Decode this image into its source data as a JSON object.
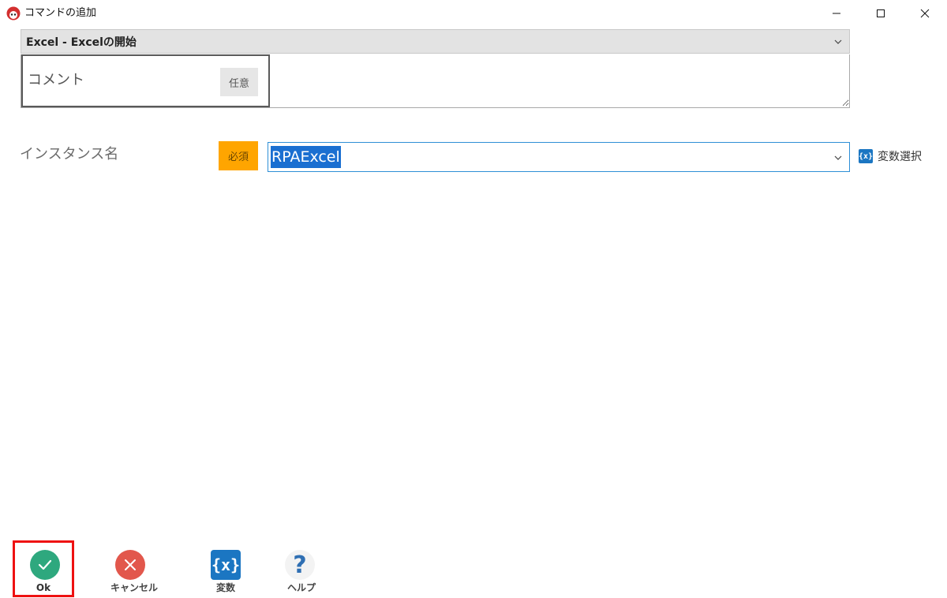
{
  "window": {
    "title": "コマンドの追加",
    "accent": "#d32f2f"
  },
  "command": {
    "selected": "Excel - Excelの開始"
  },
  "comment": {
    "label": "コメント",
    "badge": "任意",
    "value": ""
  },
  "instance": {
    "label": "インスタンス名",
    "badge": "必須",
    "value": "RPAExcel",
    "variable_select": {
      "icon_text": "{x}",
      "label": "変数選択"
    }
  },
  "toolbar": {
    "ok_label": "Ok",
    "cancel_label": "キャンセル",
    "variables_icon_text": "{x}",
    "variables_label": "変数",
    "help_icon_text": "?",
    "help_label": "ヘルプ"
  },
  "colors": {
    "ok": "#2ea87e",
    "cancel": "#e2574c",
    "variables": "#1b76c2",
    "required_badge": "#ffa500",
    "highlight_frame": "#ee1111"
  }
}
